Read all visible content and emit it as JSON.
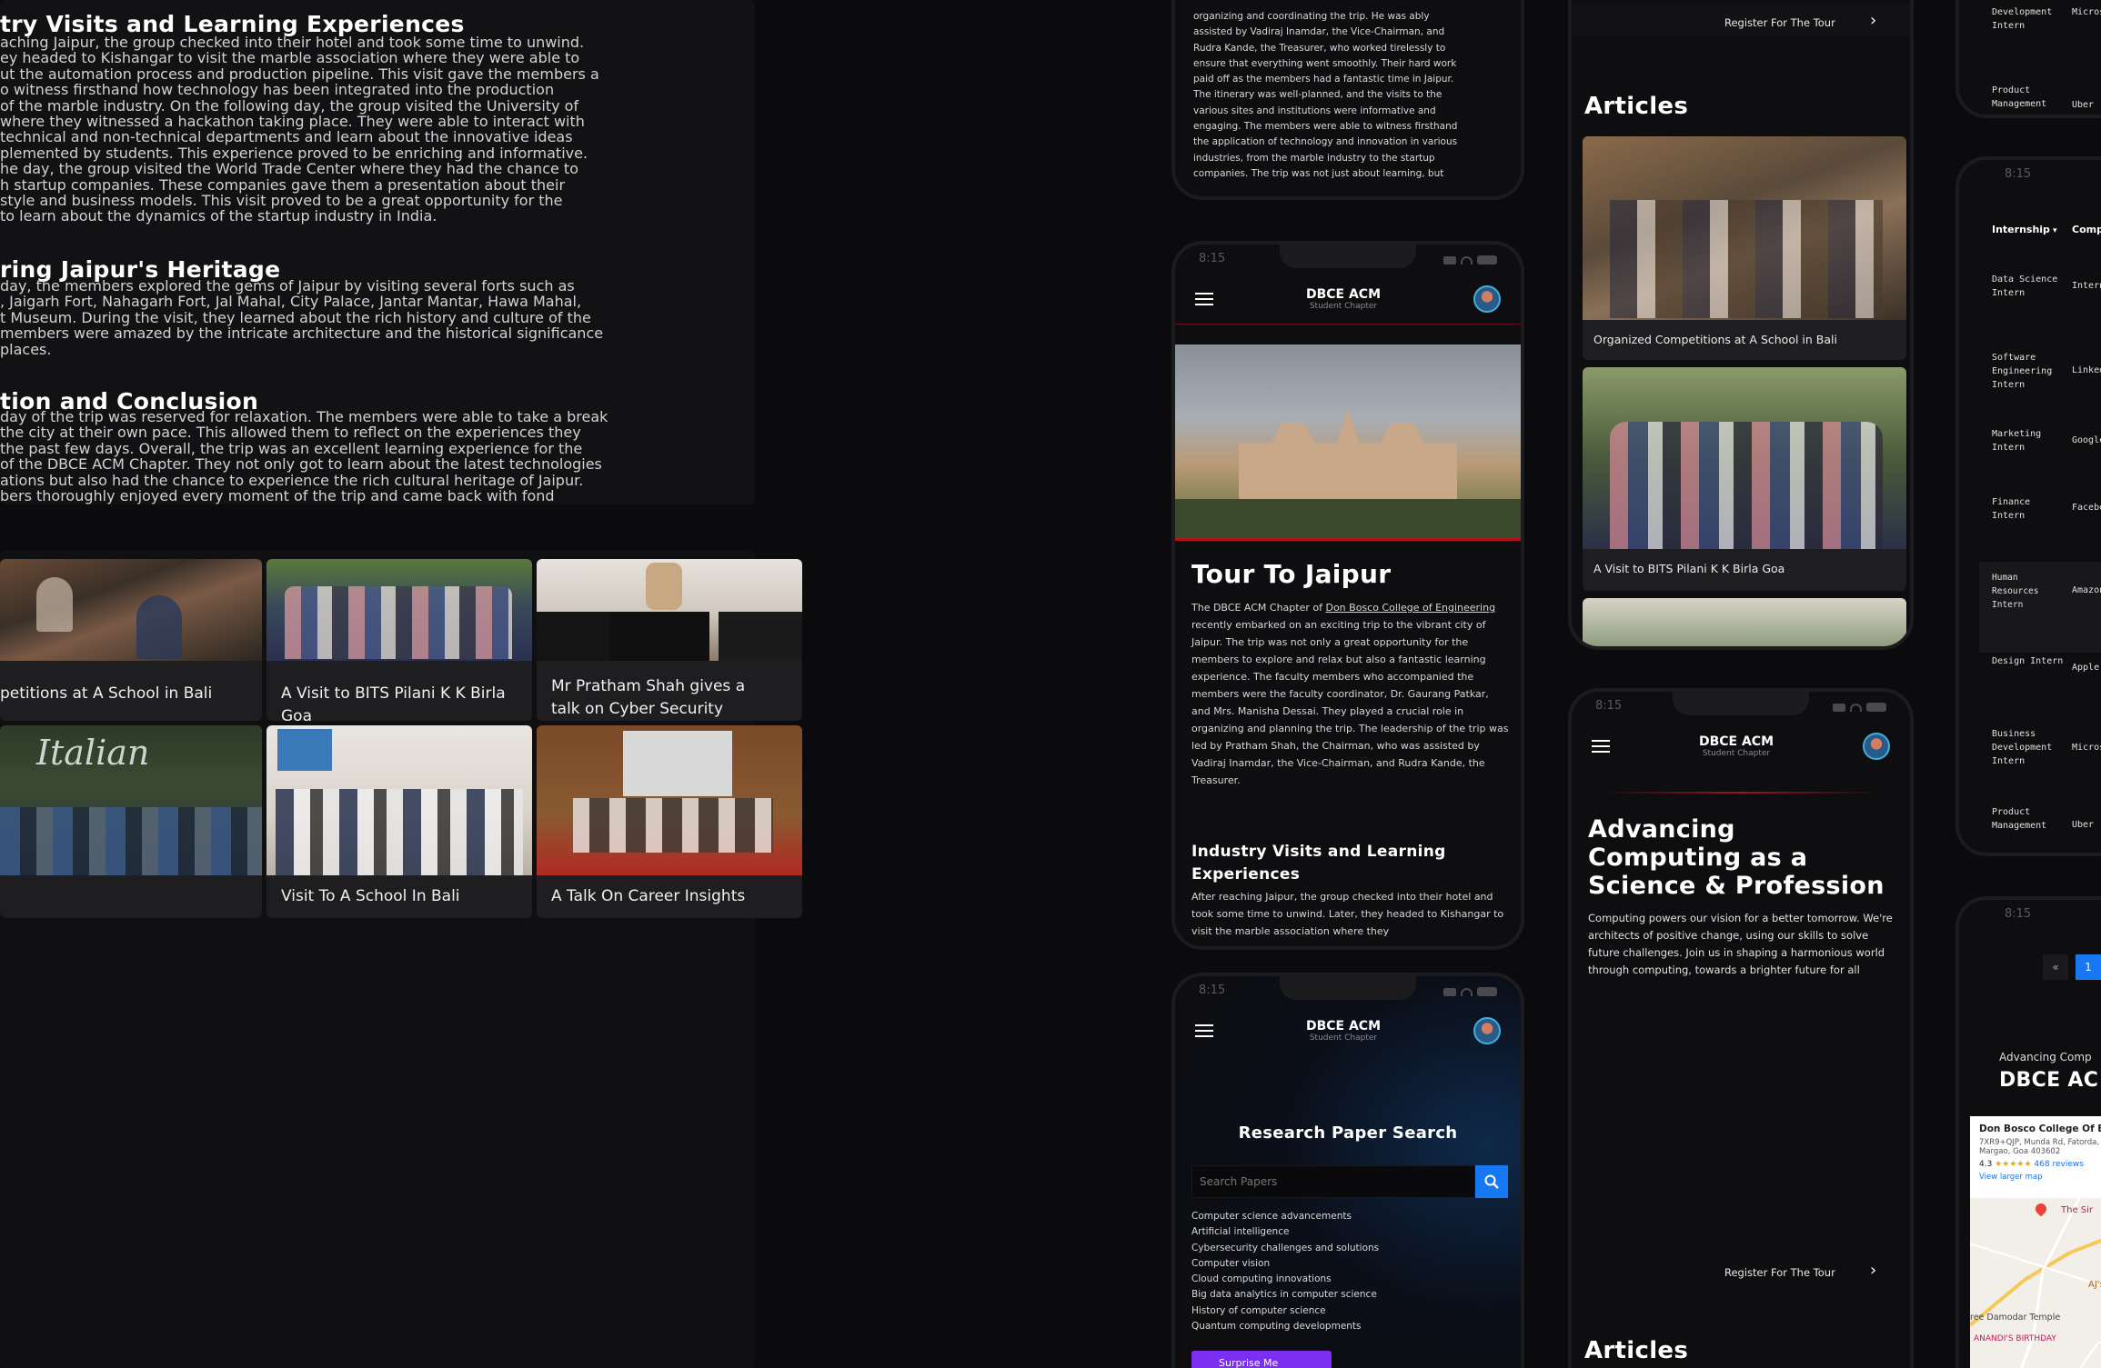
{
  "left_article": {
    "sections": [
      {
        "heading": "try Visits and Learning Experiences",
        "lines": [
          "aching Jaipur, the group checked into their hotel and took some time to unwind.",
          "ey headed to Kishangar to visit the marble association where they were able to",
          "ut the automation process and production pipeline. This visit gave the members a",
          "o witness firsthand how technology has been integrated into the production",
          "of the marble industry. On the following day, the group visited the University of",
          "where they witnessed a hackathon taking place. They were able to interact with",
          "technical and non-technical departments and learn about the innovative ideas",
          "plemented by students. This experience proved to be enriching and informative.",
          "he day, the group visited the World Trade Center where they had the chance to",
          "h startup companies. These companies gave them a presentation about their",
          "style and business models. This visit proved to be a great opportunity for the",
          "to learn about the dynamics of the startup industry in India."
        ]
      },
      {
        "heading": "ring Jaipur's Heritage",
        "lines": [
          "day, the members explored the gems of Jaipur by visiting several forts such as",
          ", Jaigarh Fort, Nahagarh Fort, Jal Mahal, City Palace, Jantar Mantar, Hawa Mahal,",
          "t Museum. During the visit, they learned about the rich history and culture of the",
          "members were amazed by the intricate architecture and the historical significance",
          "places."
        ]
      },
      {
        "heading": "tion and Conclusion",
        "lines": [
          "day of the trip was reserved for relaxation. The members were able to take a break",
          "the city at their own pace. This allowed them to reflect on the experiences they",
          "the past few days. Overall, the trip was an excellent learning experience for the",
          "of the DBCE ACM Chapter. They not only got to learn about the latest technologies",
          "ations but also had the chance to experience the rich cultural heritage of Jaipur.",
          "bers thoroughly enjoyed every moment of the trip and came back with fond"
        ]
      }
    ]
  },
  "gallery": {
    "cards": [
      {
        "caption": "petitions at A School in Bali"
      },
      {
        "caption": "A Visit to BITS Pilani K K Birla Goa"
      },
      {
        "caption": "Mr Pratham Shah gives a talk on Cyber Security"
      },
      {
        "caption": ""
      },
      {
        "caption": "Visit To A School In Bali"
      },
      {
        "caption": "A Talk On Career Insights"
      }
    ]
  },
  "mid_top_text": {
    "lines": [
      "organizing and coordinating the trip. He was ably",
      "assisted by Vadiraj Inamdar, the Vice-Chairman, and",
      "Rudra Kande, the Treasurer, who worked tirelessly to",
      "ensure that everything went smoothly. Their hard work",
      "paid off as the members had a fantastic time in Jaipur.",
      "The itinerary was well-planned, and the visits to the",
      "various sites and institutions were informative and",
      "engaging. The members were able to witness firsthand",
      "the application of technology and innovation in various",
      "industries, from the marble industry to the startup",
      "companies. The trip was not just about learning, but"
    ]
  },
  "phone_common": {
    "time": "8:15",
    "brand": "DBCE ACM",
    "brand_sub": "Student Chapter"
  },
  "phone_tour": {
    "title": "Tour To Jaipur",
    "p1_a": "The DBCE ACM Chapter of ",
    "p1_link": "Don Bosco College of Engineering",
    "p1_b": " recently embarked on an exciting trip to the vibrant city of Jaipur. The trip was not only a great opportunity for the members to explore and relax but also a fantastic learning experience. The faculty members who accompanied the members were the faculty coordinator, Dr. Gaurang Patkar, and Mrs. Manisha Dessai. They played a crucial role in organizing and planning the trip. The leadership of the trip was led by Pratham Shah, the Chairman, who was assisted by Vadiraj Inamdar, the Vice-Chairman, and Rudra Kande, the Treasurer.",
    "sub_heading": "Industry Visits and Learning Experiences",
    "p2": "After reaching Jaipur, the group checked into their hotel and took some time to unwind. Later, they headed to Kishangar to visit the marble association where they"
  },
  "phone_research": {
    "title": "Research Paper Search",
    "search_placeholder": "Search Papers",
    "topics": [
      "Computer science advancements",
      "Artificial intelligence",
      "Cybersecurity challenges and solutions",
      "Computer vision",
      "Cloud computing innovations",
      "Big data analytics in computer science",
      "History of computer science",
      "Quantum computing developments"
    ],
    "surprise_button": "Surprise Me"
  },
  "right_top": {
    "register_label": "Register For The Tour",
    "articles_heading": "Articles",
    "articles": [
      {
        "caption": "Organized Competitions at A School in Bali"
      },
      {
        "caption": "A Visit to BITS Pilani K K Birla Goa"
      }
    ]
  },
  "phone_home": {
    "hero_title": "Advancing Computing as a Science & Profession",
    "hero_text": "Computing powers our vision for a better tomorrow. We're architects of positive change, using our skills to solve future challenges. Join us in shaping a harmonious world through computing, towards a brighter future for all",
    "register_label": "Register For The Tour",
    "articles_heading": "Articles"
  },
  "far_right": {
    "top_rows": [
      {
        "role": "Development Intern",
        "company": "Micros"
      },
      {
        "role": "Product Management",
        "company": "Uber"
      }
    ],
    "table_headers": {
      "role": "Internship",
      "company": "Comp"
    },
    "rows": [
      {
        "role": "Data Science Intern",
        "company": "Intern"
      },
      {
        "role": "Software Engineering Intern",
        "company": "Linked"
      },
      {
        "role": "Marketing Intern",
        "company": "Google"
      },
      {
        "role": "Finance Intern",
        "company": "Facebo"
      },
      {
        "role": "Human Resources Intern",
        "company": "Amazon"
      },
      {
        "role": "Design Intern",
        "company": "Apple"
      },
      {
        "role": "Business Development Intern",
        "company": "Micros"
      },
      {
        "role": "Product Management",
        "company": "Uber"
      }
    ],
    "pager_prev": "«",
    "pager_current": "1",
    "footer_kicker": "Advancing Comp",
    "footer_brand": "DBCE AC",
    "map_title": "Don Bosco College Of Eng",
    "map_address": "7XR9+QJP, Munda Rd, Fatorda, Margao, Goa 403602",
    "map_rating": "4.3",
    "map_stars": "★★★★★",
    "map_reviews": "468 reviews",
    "map_link": "View larger map",
    "map_label_1": "The Sir",
    "map_label_2": "AJ's",
    "map_label_3": "ree Damodar Temple",
    "map_label_4": "ANANDI'S BIRTHDAY"
  },
  "colors": {
    "accent_blue": "#1877f2",
    "accent_red": "#9a1428",
    "purple": "#7b2ff0"
  }
}
